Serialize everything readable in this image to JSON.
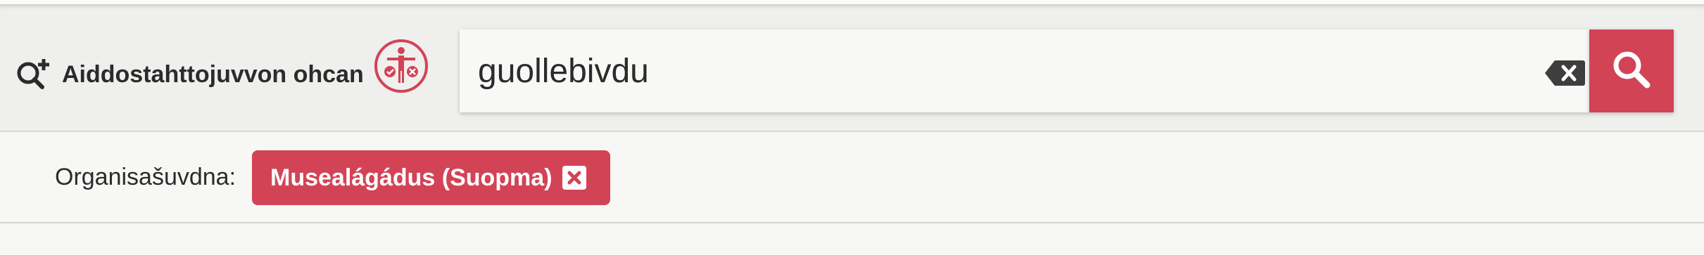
{
  "advanced_search": {
    "label": "Aiddostahttojuvvon ohcan",
    "icon": "search-plus-icon"
  },
  "rights_icon": {
    "name": "usage-rights-icon",
    "color": "#d34356"
  },
  "search": {
    "value": "guollebivdu",
    "clear_icon": "backspace-clear-icon",
    "button_icon": "search-icon"
  },
  "filters": {
    "label": "Organisašuvdna:",
    "active": [
      {
        "label": "Musealágádus (Suopma)",
        "remove_icon": "close-square-icon"
      }
    ]
  },
  "colors": {
    "accent": "#d34356",
    "band": "#efefed",
    "text": "#2b2b2b"
  }
}
